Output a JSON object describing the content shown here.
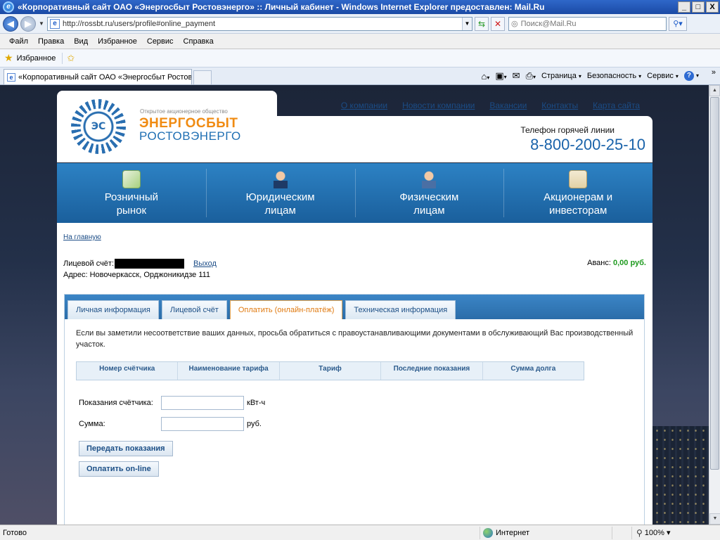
{
  "window": {
    "title": "«Корпоративный сайт ОАО «Энергосбыт Ростовэнерго» :: Личный кабинет - Windows Internet Explorer предоставлен: Mail.Ru",
    "minimize": "_",
    "maximize": "□",
    "close": "X"
  },
  "address": {
    "url": "http://rossbt.ru/users/profile#online_payment",
    "search_placeholder": "Поиск@Mail.Ru"
  },
  "menu": [
    "Файл",
    "Правка",
    "Вид",
    "Избранное",
    "Сервис",
    "Справка"
  ],
  "favorites": {
    "label": "Избранное"
  },
  "browser_tab": {
    "title": "«Корпоративный сайт ОАО «Энергосбыт Ростовэн..."
  },
  "command_bar": {
    "page": "Страница",
    "security": "Безопасность",
    "tools": "Сервис"
  },
  "site": {
    "logo": {
      "letters": "ЭС",
      "small": "Открытое акционерное общество",
      "main": "ЭНЕРГОСБЫТ",
      "sub": "РОСТОВЭНЕРГО"
    },
    "top_nav": [
      "О компании",
      "Новости компании",
      "Вакансии",
      "Контакты",
      "Карта сайта"
    ],
    "hotline_label": "Телефон горячей линии",
    "hotline_phone": "8-800-200-25-10",
    "main_nav": [
      {
        "line1": "Розничный",
        "line2": "рынок",
        "icon": "chart-icon"
      },
      {
        "line1": "Юридическим",
        "line2": "лицам",
        "icon": "businessman-icon"
      },
      {
        "line1": "Физическим",
        "line2": "лицам",
        "icon": "person-icon"
      },
      {
        "line1": "Акционерам и",
        "line2": "инвесторам",
        "icon": "documents-icon"
      }
    ]
  },
  "content": {
    "breadcrumb": "На главную",
    "account_label": "Лицевой счёт:",
    "logout": "Выход",
    "address": "Адрес: Новочеркасск, Орджоникидзе 111",
    "advance_label": "Аванс:",
    "advance_amount": "0,00 руб.",
    "tabs": [
      "Личная информация",
      "Лицевой счёт",
      "Оплатить (онлайн-платёж)",
      "Техническая информация"
    ],
    "active_tab": "Оплатить (онлайн-платёж)",
    "notice": "Если вы заметили несоответствие ваших данных, просьба обратиться с правоустанавливающими документами в обслуживающий Вас производственный участок.",
    "table_headers": [
      "Номер счётчика",
      "Наименование тарифа",
      "Тариф",
      "Последние показания",
      "Сумма долга"
    ],
    "form": {
      "meter_label": "Показания счётчика:",
      "meter_value": "",
      "meter_unit": "кВт-ч",
      "sum_label": "Сумма:",
      "sum_value": "",
      "sum_unit": "руб."
    },
    "submit_button": "Передать показания",
    "pay_button": "Оплатить on-line"
  },
  "status": {
    "text": "Готово",
    "zone": "Интернет",
    "zoom": "100%"
  }
}
